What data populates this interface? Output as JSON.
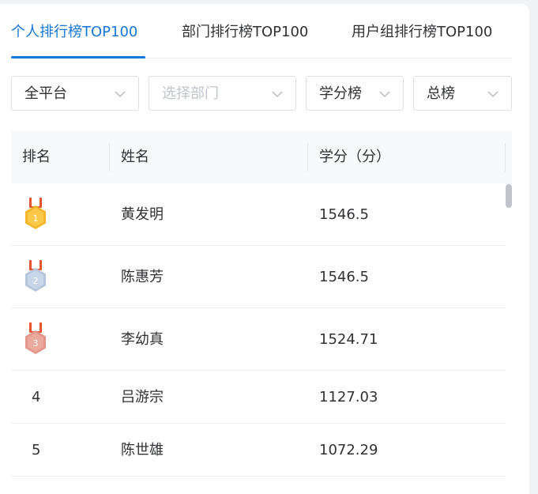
{
  "tabs": [
    {
      "label": "个人排行榜TOP100",
      "active": true
    },
    {
      "label": "部门排行榜TOP100",
      "active": false
    },
    {
      "label": "用户组排行榜TOP100",
      "active": false
    }
  ],
  "filters": {
    "platform": {
      "value": "全平台"
    },
    "department": {
      "placeholder": "选择部门"
    },
    "board_type": {
      "value": "学分榜"
    },
    "period": {
      "value": "总榜"
    }
  },
  "table": {
    "headers": {
      "rank": "排名",
      "name": "姓名",
      "score": "学分（分）"
    },
    "rows": [
      {
        "rank": "1",
        "name": "黄发明",
        "score": "1546.5"
      },
      {
        "rank": "2",
        "name": "陈惠芳",
        "score": "1546.5"
      },
      {
        "rank": "3",
        "name": "李幼真",
        "score": "1524.71"
      },
      {
        "rank": "4",
        "name": "吕游宗",
        "score": "1127.03"
      },
      {
        "rank": "5",
        "name": "陈世雄",
        "score": "1072.29"
      }
    ]
  },
  "colors": {
    "accent": "#1677d9",
    "gold": "#f6b62c",
    "silver": "#b7c6dd",
    "bronze": "#e2978a",
    "ribbon": "#e8542f"
  },
  "icons": {
    "chevron": "chevron-down-icon",
    "medal_gold": "gold-medal-icon",
    "medal_silver": "silver-medal-icon",
    "medal_bronze": "bronze-medal-icon"
  }
}
